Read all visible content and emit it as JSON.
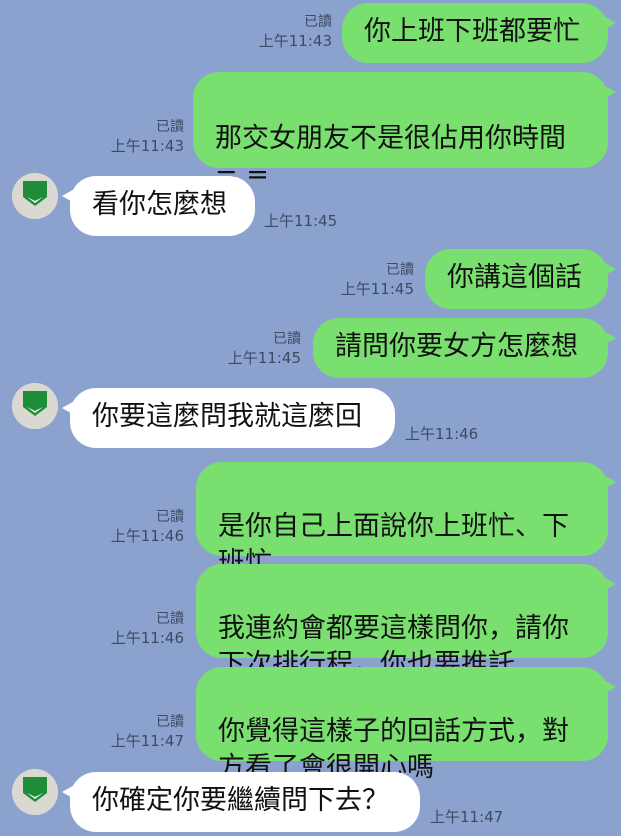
{
  "messages": [
    {
      "dir": "out",
      "text": "你上班下班都要忙",
      "read": "已讀",
      "time": "上午11:43"
    },
    {
      "dir": "out",
      "text": "那交女朋友不是很佔用你時間\n= =",
      "read": "已讀",
      "time": "上午11:43"
    },
    {
      "dir": "in",
      "text": "看你怎麼想",
      "time": "上午11:45"
    },
    {
      "dir": "out",
      "text": "你講這個話",
      "read": "已讀",
      "time": "上午11:45"
    },
    {
      "dir": "out",
      "text": "請問你要女方怎麼想",
      "read": "已讀",
      "time": "上午11:45"
    },
    {
      "dir": "in",
      "text": "你要這麼問我就這麼回",
      "time": "上午11:46"
    },
    {
      "dir": "out",
      "text": "是你自己上面說你上班忙、下\n班忙",
      "read": "已讀",
      "time": "上午11:46"
    },
    {
      "dir": "out",
      "text": "我連約會都要這樣問你，請你\n下次排行程，你也要推託",
      "read": "已讀",
      "time": "上午11:46"
    },
    {
      "dir": "out",
      "text": "你覺得這樣子的回話方式，對\n方看了會很開心嗎",
      "read": "已讀",
      "time": "上午11:47"
    },
    {
      "dir": "in",
      "text": "你確定你要繼續問下去？",
      "time": "上午11:47"
    }
  ],
  "colors": {
    "background": "#8ba2cf",
    "outgoing_bubble": "#79e070",
    "incoming_bubble": "#ffffff",
    "avatar_icon": "#1f8c3a"
  }
}
